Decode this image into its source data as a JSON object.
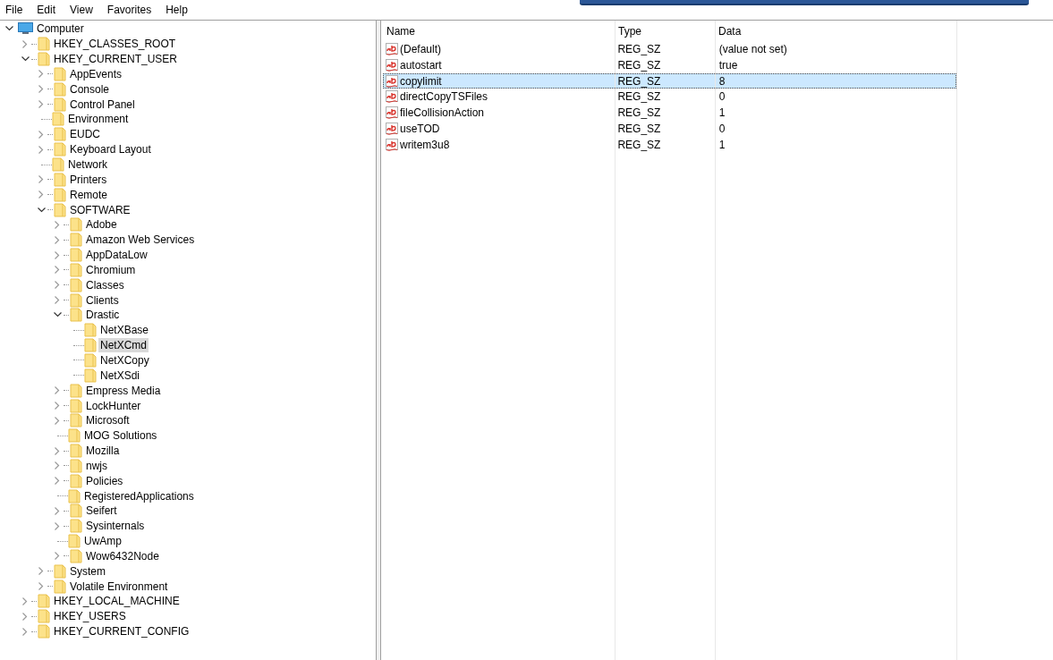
{
  "menu": [
    "File",
    "Edit",
    "View",
    "Favorites",
    "Help"
  ],
  "tree": {
    "label": "Computer",
    "kind": "computer",
    "expanded": true,
    "selected": false,
    "children": [
      {
        "label": "HKEY_CLASSES_ROOT",
        "kind": "branch",
        "expanded": false,
        "selected": false
      },
      {
        "label": "HKEY_CURRENT_USER",
        "kind": "branch",
        "expanded": true,
        "selected": false,
        "children": [
          {
            "label": "AppEvents",
            "kind": "branch",
            "expanded": false,
            "selected": false
          },
          {
            "label": "Console",
            "kind": "branch",
            "expanded": false,
            "selected": false
          },
          {
            "label": "Control Panel",
            "kind": "branch",
            "expanded": false,
            "selected": false
          },
          {
            "label": "Environment",
            "kind": "leaf",
            "selected": false
          },
          {
            "label": "EUDC",
            "kind": "branch",
            "expanded": false,
            "selected": false
          },
          {
            "label": "Keyboard Layout",
            "kind": "branch",
            "expanded": false,
            "selected": false
          },
          {
            "label": "Network",
            "kind": "leaf",
            "selected": false
          },
          {
            "label": "Printers",
            "kind": "branch",
            "expanded": false,
            "selected": false
          },
          {
            "label": "Remote",
            "kind": "branch",
            "expanded": false,
            "selected": false
          },
          {
            "label": "SOFTWARE",
            "kind": "branch",
            "expanded": true,
            "selected": false,
            "children": [
              {
                "label": "Adobe",
                "kind": "branch",
                "expanded": false,
                "selected": false
              },
              {
                "label": "Amazon Web Services",
                "kind": "branch",
                "expanded": false,
                "selected": false
              },
              {
                "label": "AppDataLow",
                "kind": "branch",
                "expanded": false,
                "selected": false
              },
              {
                "label": "Chromium",
                "kind": "branch",
                "expanded": false,
                "selected": false
              },
              {
                "label": "Classes",
                "kind": "branch",
                "expanded": false,
                "selected": false
              },
              {
                "label": "Clients",
                "kind": "branch",
                "expanded": false,
                "selected": false
              },
              {
                "label": "Drastic",
                "kind": "branch",
                "expanded": true,
                "selected": false,
                "children": [
                  {
                    "label": "NetXBase",
                    "kind": "leaf",
                    "selected": false
                  },
                  {
                    "label": "NetXCmd",
                    "kind": "leaf",
                    "selected": true
                  },
                  {
                    "label": "NetXCopy",
                    "kind": "leaf",
                    "selected": false
                  },
                  {
                    "label": "NetXSdi",
                    "kind": "leaf",
                    "selected": false
                  }
                ]
              },
              {
                "label": "Empress Media",
                "kind": "branch",
                "expanded": false,
                "selected": false
              },
              {
                "label": "LockHunter",
                "kind": "branch",
                "expanded": false,
                "selected": false
              },
              {
                "label": "Microsoft",
                "kind": "branch",
                "expanded": false,
                "selected": false
              },
              {
                "label": "MOG Solutions",
                "kind": "leaf",
                "selected": false
              },
              {
                "label": "Mozilla",
                "kind": "branch",
                "expanded": false,
                "selected": false
              },
              {
                "label": "nwjs",
                "kind": "branch",
                "expanded": false,
                "selected": false
              },
              {
                "label": "Policies",
                "kind": "branch",
                "expanded": false,
                "selected": false
              },
              {
                "label": "RegisteredApplications",
                "kind": "leaf",
                "selected": false
              },
              {
                "label": "Seifert",
                "kind": "branch",
                "expanded": false,
                "selected": false
              },
              {
                "label": "Sysinternals",
                "kind": "branch",
                "expanded": false,
                "selected": false
              },
              {
                "label": "UwAmp",
                "kind": "leaf",
                "selected": false
              },
              {
                "label": "Wow6432Node",
                "kind": "branch",
                "expanded": false,
                "selected": false
              }
            ]
          },
          {
            "label": "System",
            "kind": "branch",
            "expanded": false,
            "selected": false
          },
          {
            "label": "Volatile Environment",
            "kind": "branch",
            "expanded": false,
            "selected": false
          }
        ]
      },
      {
        "label": "HKEY_LOCAL_MACHINE",
        "kind": "branch",
        "expanded": false,
        "selected": false
      },
      {
        "label": "HKEY_USERS",
        "kind": "branch",
        "expanded": false,
        "selected": false
      },
      {
        "label": "HKEY_CURRENT_CONFIG",
        "kind": "branch",
        "expanded": false,
        "selected": false
      }
    ]
  },
  "table": {
    "columns": [
      "Name",
      "Type",
      "Data"
    ],
    "rows": [
      {
        "name": "(Default)",
        "type": "REG_SZ",
        "data": "(value not set)",
        "selected": false
      },
      {
        "name": "autostart",
        "type": "REG_SZ",
        "data": "true",
        "selected": false
      },
      {
        "name": "copylimit",
        "type": "REG_SZ",
        "data": "8",
        "selected": true
      },
      {
        "name": "directCopyTSFiles",
        "type": "REG_SZ",
        "data": "0",
        "selected": false
      },
      {
        "name": "fileCollisionAction",
        "type": "REG_SZ",
        "data": "1",
        "selected": false
      },
      {
        "name": "useTOD",
        "type": "REG_SZ",
        "data": "0",
        "selected": false
      },
      {
        "name": "writem3u8",
        "type": "REG_SZ",
        "data": "1",
        "selected": false
      }
    ]
  }
}
